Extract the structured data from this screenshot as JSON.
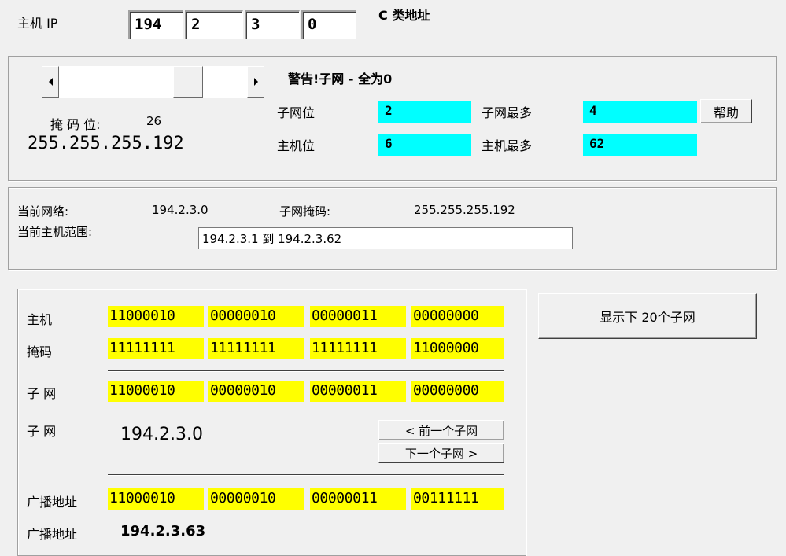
{
  "host_ip": {
    "label": "主机 IP",
    "octets": [
      "194",
      "2",
      "3",
      "0"
    ],
    "class_label": "C 类地址"
  },
  "subnet_panel": {
    "warning": "警告!子网 - 全为0",
    "mask_bits_label": "掩 码 位:",
    "mask_bits_value": "26",
    "mask_dotted": "255.255.255.192",
    "subnet_bits_label": "子网位",
    "subnet_bits_value": "2",
    "max_subnets_label": "子网最多",
    "max_subnets_value": "4",
    "host_bits_label": "主机位",
    "host_bits_value": "6",
    "max_hosts_label": "主机最多",
    "max_hosts_value": "62",
    "help_button": "帮助",
    "slider_level": 0.72
  },
  "network_panel": {
    "current_network_label": "当前网络:",
    "current_network_value": "194.2.3.0",
    "subnet_mask_label": "子网掩码:",
    "subnet_mask_value": "255.255.255.192",
    "host_range_label": "当前主机范围:",
    "host_range_value": "194.2.3.1 到 194.2.3.62"
  },
  "binary_panel": {
    "host_label": "主机",
    "host_bits": [
      "11000010",
      "00000010",
      "00000011",
      "00000000"
    ],
    "mask_label": "掩码",
    "mask_bits": [
      "11111111",
      "11111111",
      "11111111",
      "11000000"
    ],
    "subnet_label": "子 网",
    "subnet_bits": [
      "11000010",
      "00000010",
      "00000011",
      "00000000"
    ],
    "subnet_label2": "子 网",
    "subnet_dotted": "194.2.3.0",
    "prev_button": "< 前一个子网",
    "next_button": "下一个子网 >",
    "broadcast_label": "广播地址",
    "broadcast_bits": [
      "11000010",
      "00000010",
      "00000011",
      "00111111"
    ],
    "broadcast_label2": "广播地址",
    "broadcast_dotted": "194.2.3.63"
  },
  "show_next_button": "显示下 20个子网",
  "colors": {
    "background": "#f0f0f0",
    "cyan_field": "#00ffff",
    "binary_highlight": "#ffff00"
  }
}
